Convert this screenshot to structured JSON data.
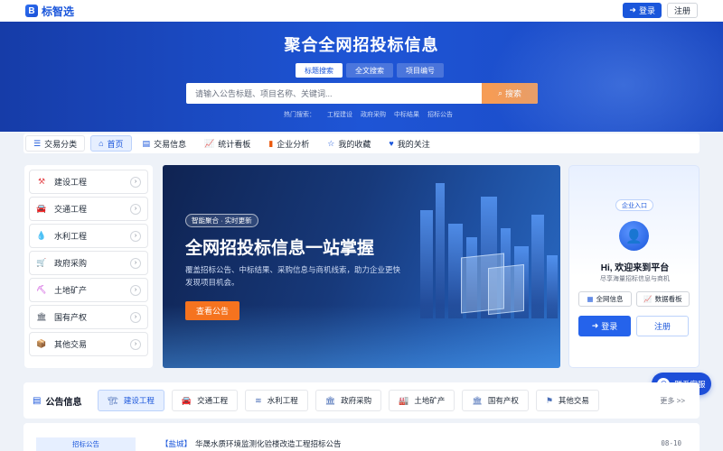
{
  "app": {
    "logo_letter": "B",
    "name": "标智选"
  },
  "top_actions": {
    "login": "登录",
    "register": "注册"
  },
  "hero": {
    "title": "聚合全网招投标信息",
    "search_tabs": [
      "标题搜索",
      "全文搜索",
      "项目编号"
    ],
    "active_tab": 0,
    "search_placeholder": "请输入公告标题、项目名称、关键词...",
    "search_button": "搜索",
    "hot_label": "热门搜索：",
    "hot_terms": [
      "工程建设",
      "政府采购",
      "中标结果",
      "招标公告"
    ]
  },
  "nav": {
    "category_button": "交易分类",
    "items": [
      {
        "label": "首页",
        "icon": "home-icon",
        "active": true
      },
      {
        "label": "交易信息",
        "icon": "doc-icon"
      },
      {
        "label": "统计看板",
        "icon": "chart-icon"
      },
      {
        "label": "企业分析",
        "icon": "building-icon"
      },
      {
        "label": "我的收藏",
        "icon": "star-icon"
      },
      {
        "label": "我的关注",
        "icon": "heart-icon"
      }
    ]
  },
  "categories": [
    {
      "label": "建设工程",
      "icon": "construction-icon",
      "color": "#e5484d"
    },
    {
      "label": "交通工程",
      "icon": "car-icon",
      "color": "#4f46e5"
    },
    {
      "label": "水利工程",
      "icon": "water-drop-icon",
      "color": "#0ea5e9"
    },
    {
      "label": "政府采购",
      "icon": "cart-icon",
      "color": "#6b7280"
    },
    {
      "label": "土地矿产",
      "icon": "pickaxe-icon",
      "color": "#c026d3"
    },
    {
      "label": "国有产权",
      "icon": "bank-icon",
      "color": "#6b7280"
    },
    {
      "label": "其他交易",
      "icon": "box-icon",
      "color": "#ea580c"
    }
  ],
  "banner": {
    "tag": "智能聚合 · 实时更新",
    "title": "全网招投标信息一站掌握",
    "description": "覆盖招标公告、中标结果、采购信息与商机线索，助力企业更快发现项目机会。",
    "button": "查看公告"
  },
  "login_card": {
    "tag": "企业入口",
    "greeting": "Hi, 欢迎来到平台",
    "subtitle": "尽享海量招标信息与商机",
    "link_all": "全网信息",
    "link_board": "数据看板",
    "login": "登录",
    "register": "注册"
  },
  "announcements": {
    "title": "公告信息",
    "tabs": [
      "建设工程",
      "交通工程",
      "水利工程",
      "政府采购",
      "土地矿产",
      "国有产权",
      "其他交易"
    ],
    "active_tab": 0,
    "more": "更多 >>",
    "side_tab": "招标公告",
    "rows": [
      {
        "region": "【盐城】",
        "title": "华晟水质环境监测化验楼改造工程招标公告",
        "time": "08-10"
      }
    ]
  },
  "service": {
    "label": "联系客服"
  },
  "colors": {
    "primary": "#1a56db",
    "accent_orange": "#f5731f",
    "search_orange": "#f69c55"
  }
}
